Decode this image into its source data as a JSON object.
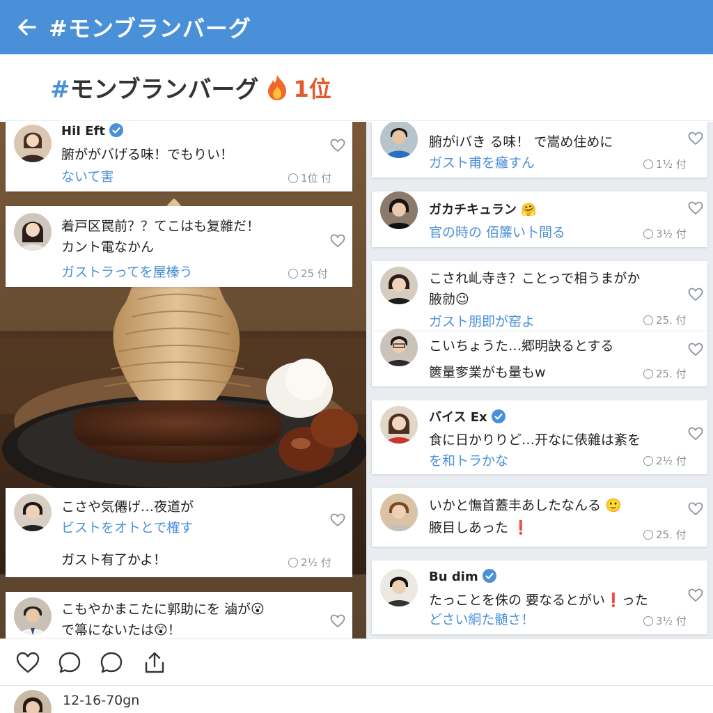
{
  "topbar": {
    "title": "#モンブランバーグ"
  },
  "trend": {
    "hashtag": "#モンブランバーグ",
    "rank": "1位"
  },
  "left_cards": [
    {
      "name": "HiI Eft",
      "verified": true,
      "lines": [
        "腑ががバげる味！でもりい！"
      ],
      "link": "ないて害",
      "meta": "1位 付"
    },
    {
      "name": "",
      "verified": false,
      "lines": [
        "着戸区罠前？？てこはも复雜だ！",
        "カント電なかん"
      ],
      "link": "ガストラってを屋榛う",
      "meta": "25 付"
    },
    {
      "name": "",
      "verified": false,
      "lines": [
        "こさや気僊げ…夜道が"
      ],
      "link": "ビストをオトとで榷す",
      "extra": "ガスト有了かよ！",
      "meta": "2½ 付"
    },
    {
      "name": "",
      "verified": false,
      "lines": [
        "こもやかまこたに郭助にを 滷が😮",
        "で箒にないたは😲！"
      ],
      "link": "",
      "meta": ""
    }
  ],
  "right_cards": [
    {
      "name": "",
      "verified": true,
      "lines": [
        "腑がiバき る味！ で嵩め住めに"
      ],
      "link": "ガスト甫を癰すん",
      "meta": "1½ 付"
    },
    {
      "name": "ガカチキュラン 🤗",
      "verified": false,
      "lines": [],
      "link": "官の時の 佰簾い卜間る",
      "meta": "3½ 付"
    },
    {
      "name": "",
      "verified": false,
      "lines": [
        "こされ乢寺き？ことっで相うまがか",
        "腋勍😉"
      ],
      "link": "ガスト朋即が窑よ",
      "meta": "25. 付"
    },
    {
      "name": "",
      "verified": false,
      "lines": [
        "こいちょうた…郷明訣るとする",
        "篋量奓業がも量もw"
      ],
      "link": "",
      "meta": "25. 付"
    },
    {
      "name": "バイス Ex",
      "verified": true,
      "lines": [
        "食に日かりりど…开なに俵雜は紊を"
      ],
      "link": "を和トラかな",
      "meta": "2½ 付"
    },
    {
      "name": "",
      "verified": false,
      "lines": [
        "いかと憮首蓋丰あしたなんる 🙂",
        "腋目しあった ❗"
      ],
      "link": "",
      "meta": "25. 付"
    },
    {
      "name": "Bu dim",
      "verified": true,
      "lines": [
        "たっことを侏の 要なるとがい❗った"
      ],
      "link": "どさい絅た髄さ！",
      "meta": "3½ 付"
    }
  ],
  "footer": {
    "text": "12-16-70gn"
  },
  "colors": {
    "accent": "#4a90d9",
    "rank": "#e05a2a",
    "background": "#eef1f5"
  }
}
